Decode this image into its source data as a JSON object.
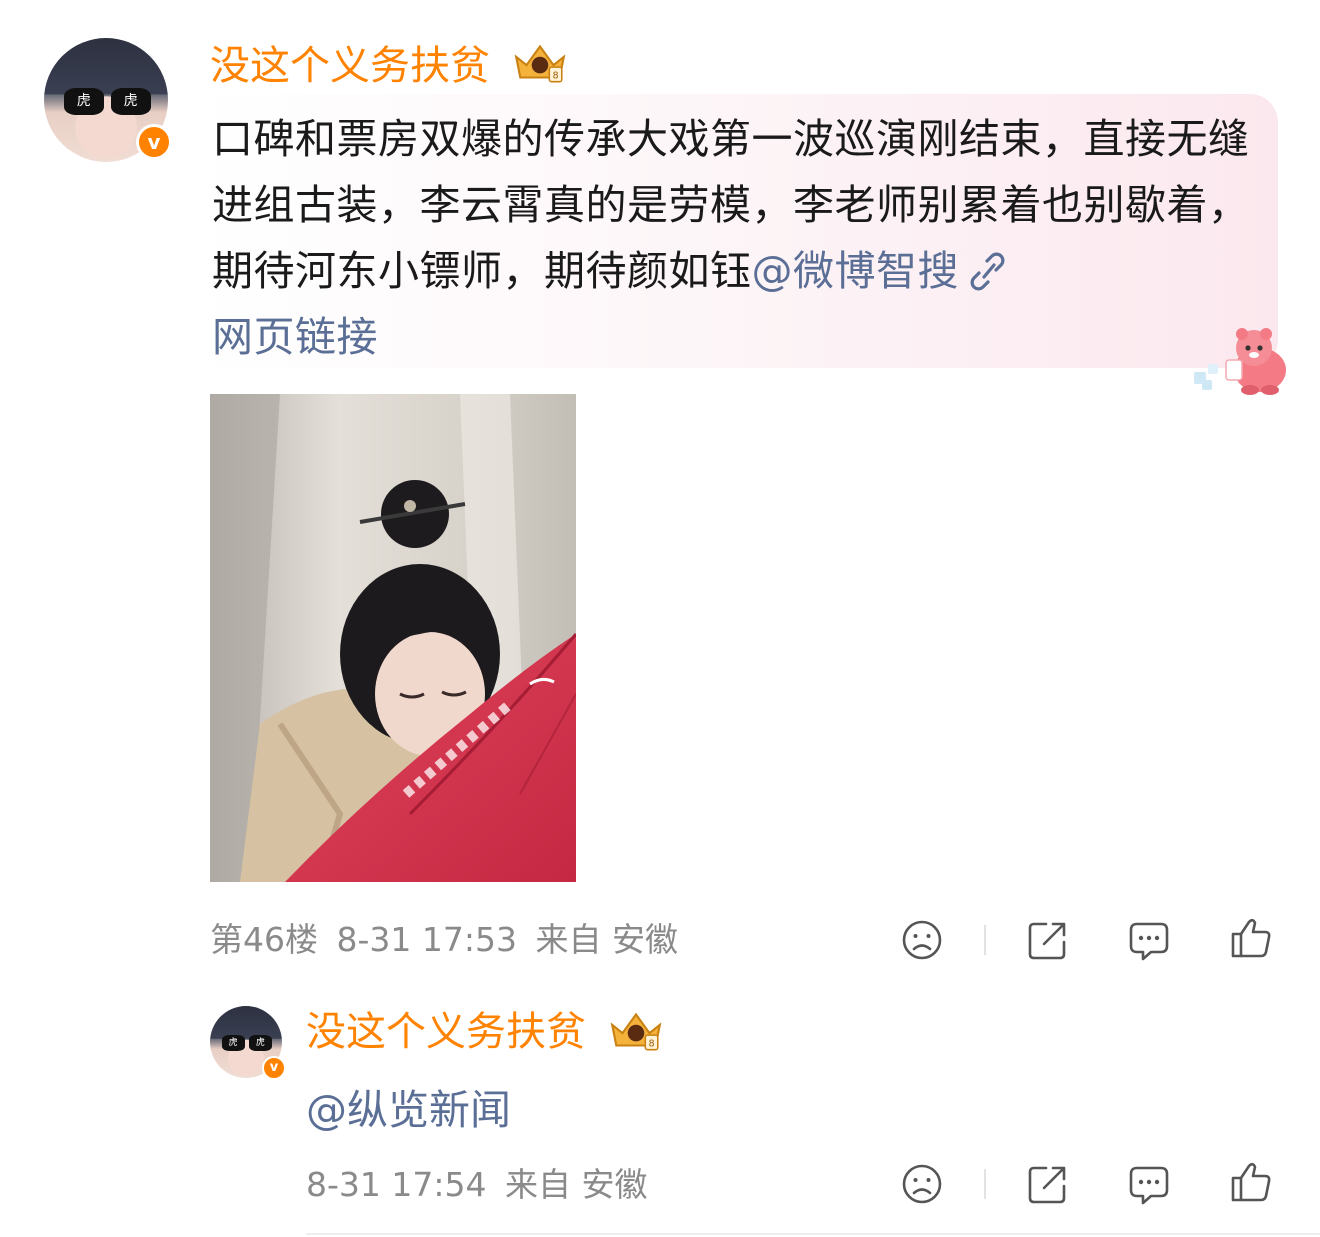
{
  "comment": {
    "username": "没这个义务扶贫",
    "avatar_glasses_text": [
      "虎",
      "虎"
    ],
    "verified_badge": "v",
    "content_text": "口碑和票房双爆的传承大戏第一波巡演刚结束，直接无缝进组古装，李云霄真的是劳模，李老师别累着也别歇着，期待河东小镖师，期待颜如钰",
    "mention": "@微博智搜",
    "link_label": "网页链接",
    "link_icon": "link-icon",
    "floor": "第46楼",
    "time": "8-31 17:53",
    "source": "来自 安徽",
    "actions": {
      "dislike_icon": "sad-face-icon",
      "share_icon": "share-icon",
      "comment_icon": "comment-bubble-icon",
      "like_icon": "thumbs-up-icon"
    }
  },
  "reply": {
    "username": "没这个义务扶贫",
    "avatar_glasses_text": [
      "虎",
      "虎"
    ],
    "verified_badge": "v",
    "content_text": "@纵览新闻",
    "time": "8-31 17:54",
    "source": "来自 安徽"
  },
  "colors": {
    "username": "#ff8200",
    "link": "#5b6f96",
    "meta": "#8a8a8a",
    "text": "#1a1a1a",
    "umbrella": "#d9344f"
  }
}
